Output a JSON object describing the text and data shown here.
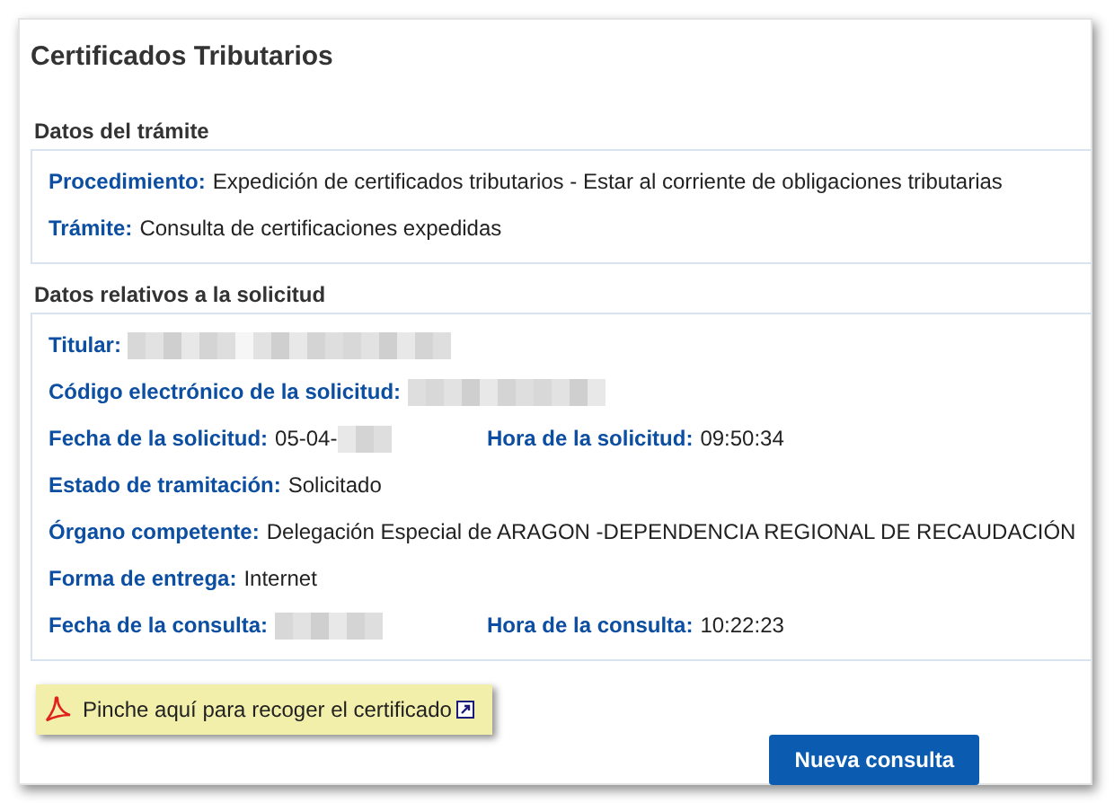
{
  "page": {
    "title": "Certificados Tributarios"
  },
  "sections": [
    {
      "heading": "Datos del trámite",
      "rows": [
        {
          "items": [
            {
              "label": "Procedimiento:",
              "value": "Expedición de certificados tributarios - Estar al corriente de obligaciones tributarias"
            }
          ]
        },
        {
          "items": [
            {
              "label": "Trámite:",
              "value": "Consulta de certificaciones expedidas"
            }
          ]
        }
      ]
    },
    {
      "heading": "Datos relativos a la solicitud",
      "rows": [
        {
          "items": [
            {
              "label": "Titular:",
              "blurred": true
            }
          ]
        },
        {
          "items": [
            {
              "label": "Código electrónico de la solicitud:",
              "blurred": true
            }
          ]
        },
        {
          "items": [
            {
              "label": "Fecha de la solicitud:",
              "value": "05-04-",
              "blurred": true
            },
            {
              "label": "Hora de la solicitud:",
              "value": "09:50:34"
            }
          ]
        },
        {
          "items": [
            {
              "label": "Estado de tramitación:",
              "value": "Solicitado"
            }
          ]
        },
        {
          "items": [
            {
              "label": "Órgano competente:",
              "value": "Delegación Especial de ARAGON -DEPENDENCIA REGIONAL DE RECAUDACIÓN"
            }
          ]
        },
        {
          "items": [
            {
              "label": "Forma de entrega:",
              "value": "Internet"
            }
          ]
        },
        {
          "items": [
            {
              "label": "Fecha de la consulta:",
              "blurred": true
            },
            {
              "label": "Hora de la consulta:",
              "value": "10:22:23"
            }
          ]
        }
      ]
    }
  ],
  "certificate_link": {
    "label": "Pinche aquí para recoger el certificado"
  },
  "button": {
    "label": "Nueva consulta"
  }
}
